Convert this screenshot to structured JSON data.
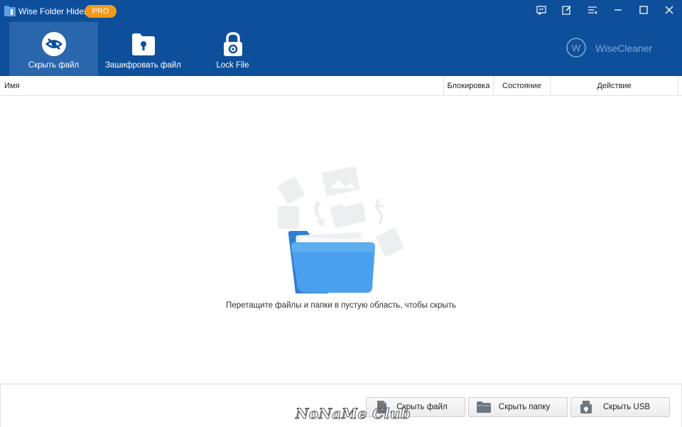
{
  "app": {
    "title": "Wise Folder Hider",
    "badge": "PRO"
  },
  "toolbar": {
    "items": [
      {
        "label": "Скрыть файл",
        "icon": "eye-slash-icon",
        "active": true
      },
      {
        "label": "Зашифровать файл",
        "icon": "folder-lock-icon",
        "active": false
      },
      {
        "label": "Lock File",
        "icon": "padlock-icon",
        "active": false
      }
    ]
  },
  "brand": {
    "name": "WiseCleaner",
    "logo_letter": "W"
  },
  "window_controls": [
    "feedback-icon",
    "edit-icon",
    "menu-icon",
    "minimize-icon",
    "maximize-icon",
    "close-icon"
  ],
  "table": {
    "columns": [
      "Имя",
      "Блокировка",
      "Состояние",
      "Действие"
    ],
    "rows": []
  },
  "empty_state": {
    "hint": "Перетащите файлы и папки в пустую область, чтобы скрыть"
  },
  "footer": {
    "buttons": [
      {
        "label": "Скрыть файл",
        "icon": "file-icon"
      },
      {
        "label": "Скрыть папку",
        "icon": "folder-icon"
      },
      {
        "label": "Скрыть USB",
        "icon": "usb-icon"
      }
    ],
    "watermark": "NoNaMe Club"
  },
  "colors": {
    "header_bg": "#0d4f9a",
    "active_tab": "#2a66ac",
    "pro_badge": "#f39a1c",
    "folder_blue": "#3d8fdc"
  }
}
